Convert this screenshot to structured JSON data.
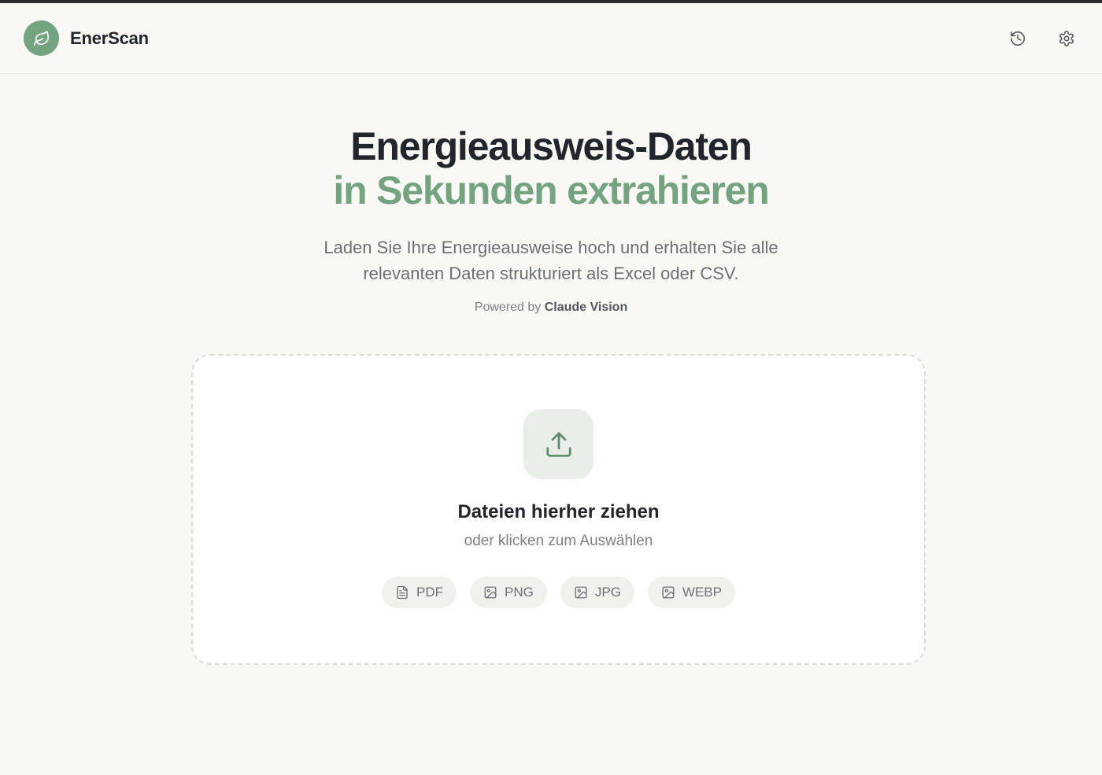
{
  "header": {
    "brand_name": "EnerScan",
    "logo_icon": "leaf-icon",
    "actions": [
      {
        "icon": "history-icon"
      },
      {
        "icon": "gear-icon"
      }
    ]
  },
  "hero": {
    "title_line1": "Energieausweis-Daten",
    "title_line2": "in Sekunden extrahieren",
    "subtitle": "Laden Sie Ihre Energieausweise hoch und erhalten Sie alle relevanten Daten strukturiert als Excel oder CSV.",
    "powered_prefix": "Powered by",
    "powered_brand": "Claude Vision"
  },
  "dropzone": {
    "icon": "upload-icon",
    "title": "Dateien hierher ziehen",
    "subtitle": "oder klicken zum Auswählen",
    "formats": [
      {
        "label": "PDF",
        "icon": "document-icon"
      },
      {
        "label": "PNG",
        "icon": "image-icon"
      },
      {
        "label": "JPG",
        "icon": "image-icon"
      },
      {
        "label": "WEBP",
        "icon": "image-icon"
      }
    ]
  },
  "colors": {
    "accent": "#73a37f",
    "background": "#f9f8f5",
    "text": "#22252a",
    "muted": "#6c6f73"
  }
}
